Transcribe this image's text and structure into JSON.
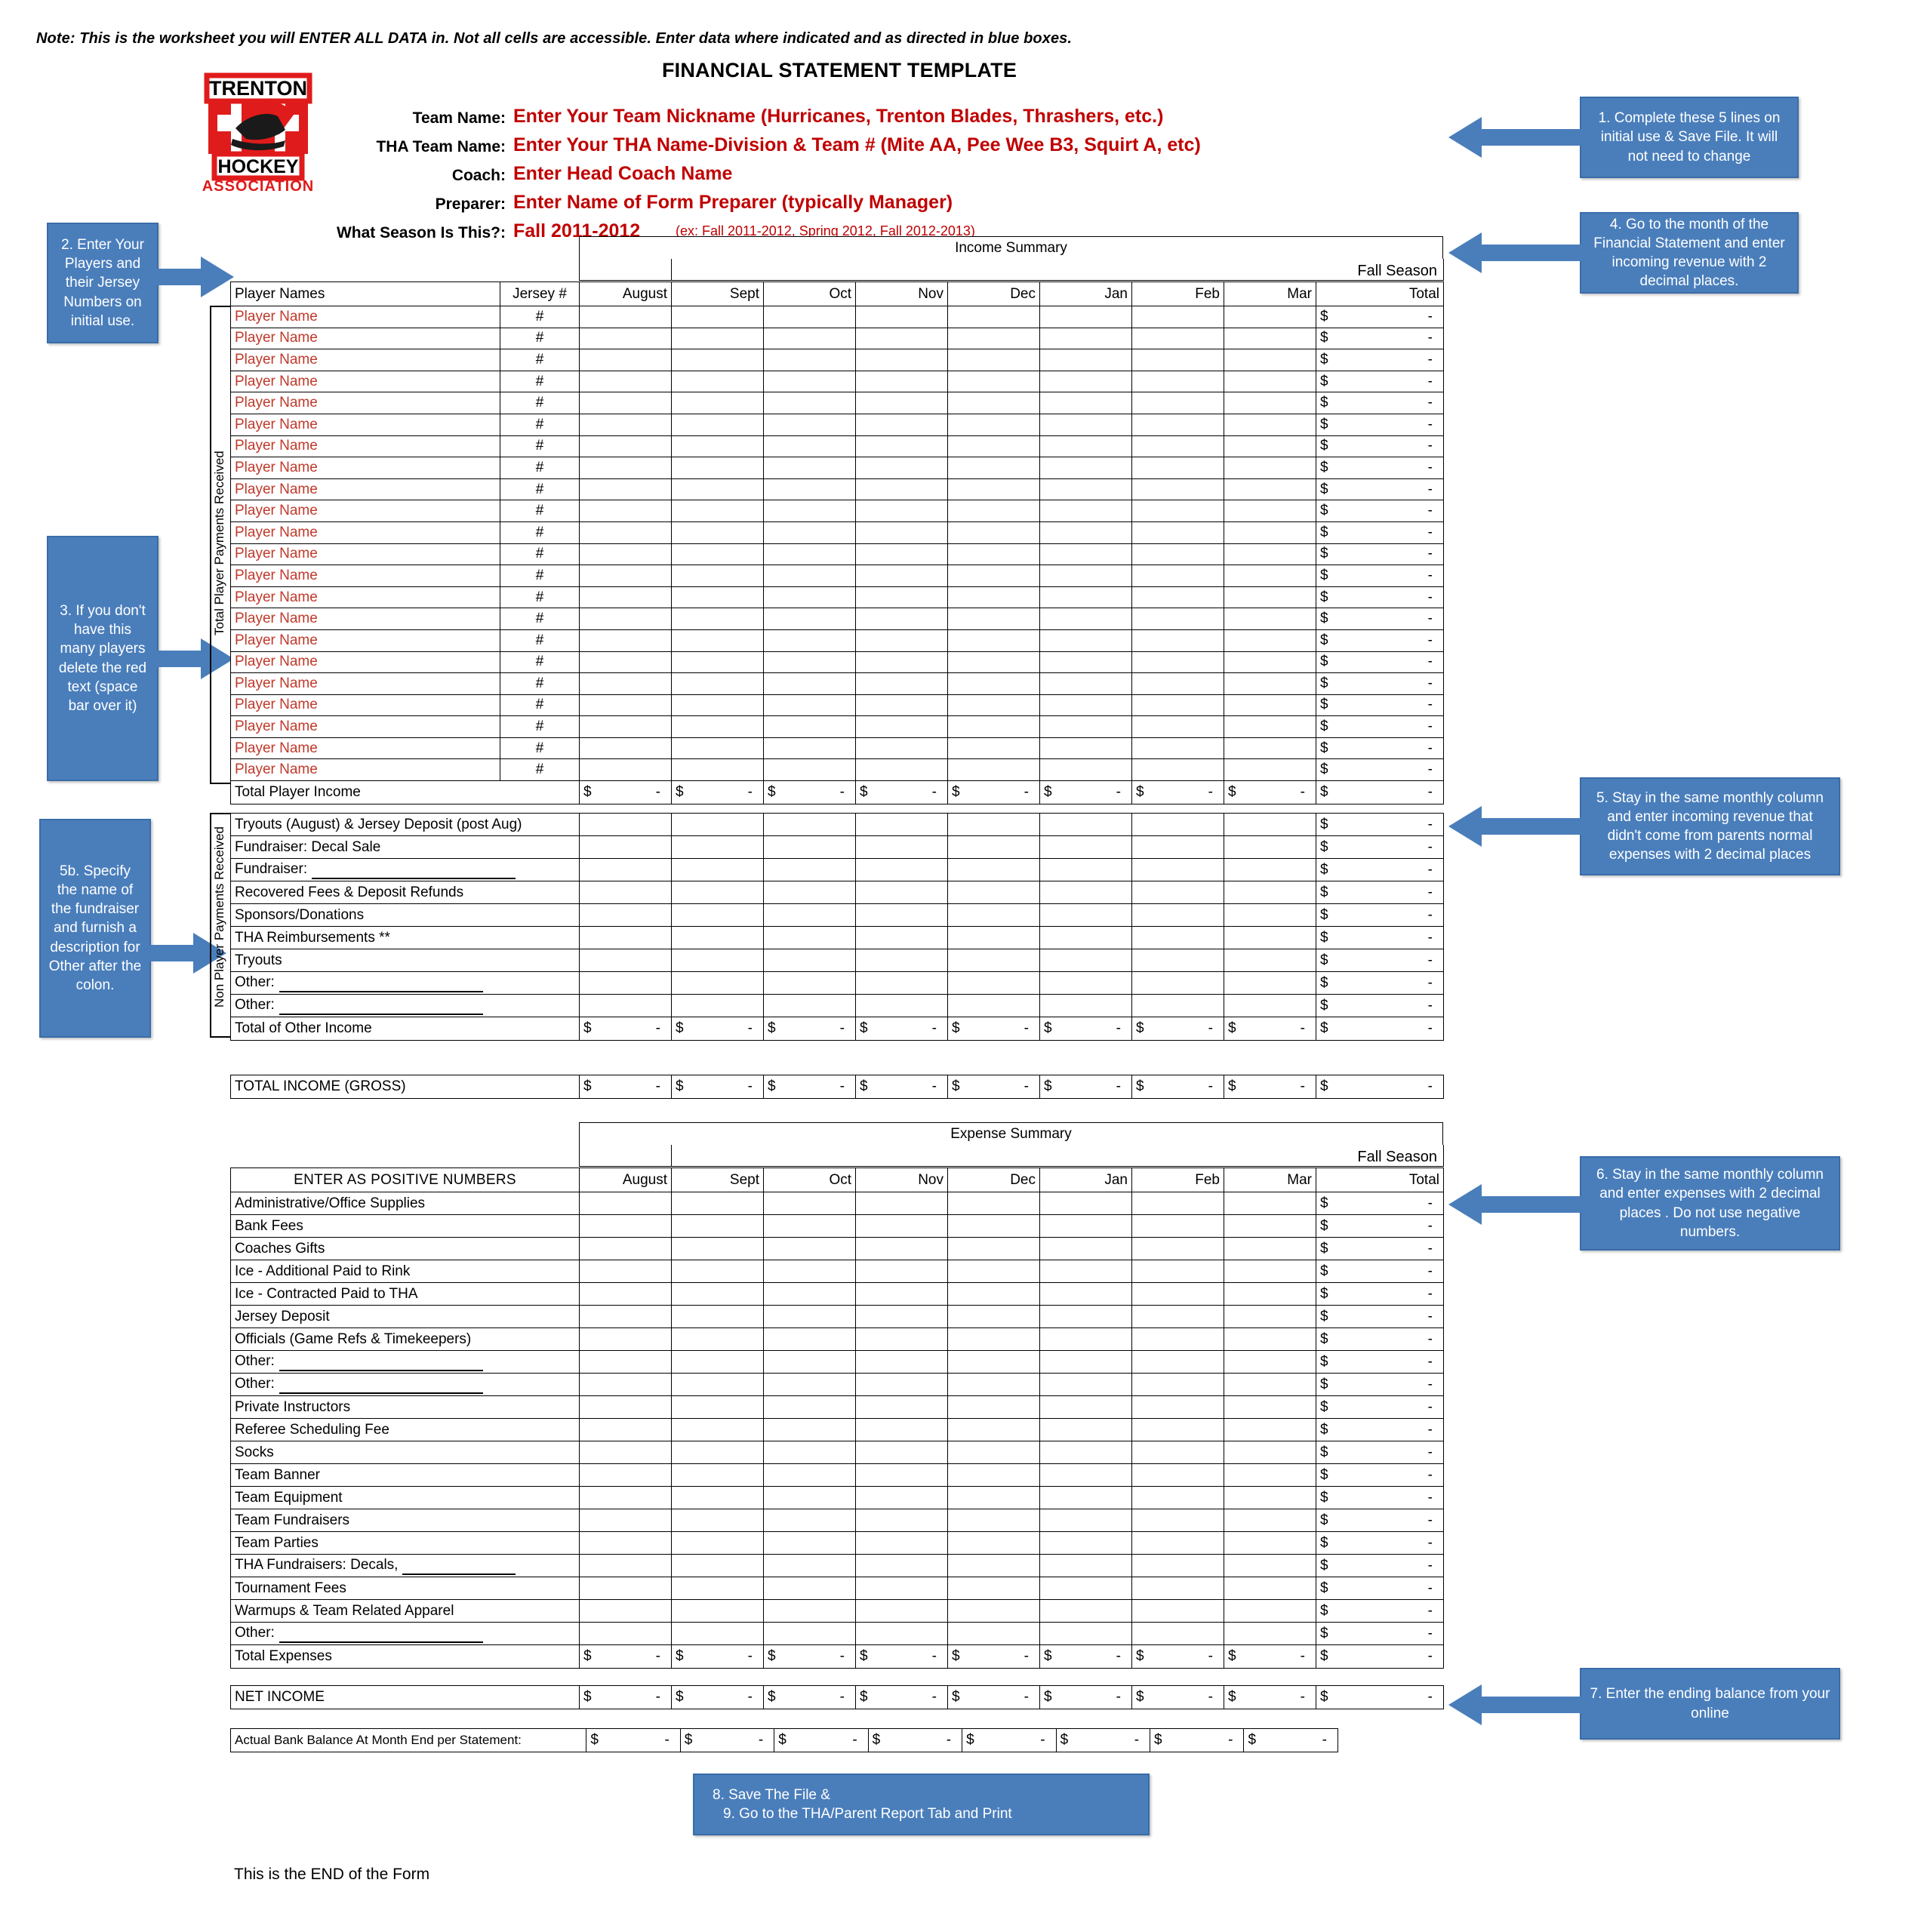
{
  "note": "Note:  This is the worksheet you will ENTER ALL DATA in.  Not all cells are accessible.  Enter data where indicated and as directed in blue boxes.",
  "title": "FINANCIAL STATEMENT TEMPLATE",
  "logo": {
    "line1": "TRENTON",
    "line2": "HOCKEY",
    "line3": "ASSOCIATION",
    "color": "#e01b1b"
  },
  "header_fields": [
    {
      "label": "Team Name:",
      "value": "Enter Your Team Nickname (Hurricanes, Trenton Blades, Thrashers, etc.)",
      "example": ""
    },
    {
      "label": "THA Team Name:",
      "value": "Enter Your THA Name-Division & Team # (Mite AA, Pee Wee B3, Squirt A, etc)",
      "example": ""
    },
    {
      "label": "Coach:",
      "value": "Enter Head Coach Name",
      "example": ""
    },
    {
      "label": "Preparer:",
      "value": "Enter Name of Form Preparer (typically Manager)",
      "example": ""
    },
    {
      "label": "What Season Is This?:",
      "value": "Fall 2011-2012",
      "example": "(ex: Fall 2011-2012, Spring 2012, Fall 2012-2013)"
    }
  ],
  "callouts": [
    {
      "id": "callout-1",
      "text": "1.  Complete these 5  lines on initial use & Save File.  It will not need to change"
    },
    {
      "id": "callout-2",
      "text": "2.  Enter Your Players and their Jersey Numbers on initial use."
    },
    {
      "id": "callout-3",
      "text": "3.  If you don't have this many players delete the red text (space bar over it)"
    },
    {
      "id": "callout-4",
      "text": "4.  Go to the month of the Financial Statement and enter incoming revenue with 2 decimal places."
    },
    {
      "id": "callout-5",
      "text": "5.  Stay in the same monthly column and enter incoming revenue that didn't come from parents normal expenses with 2 decimal places"
    },
    {
      "id": "callout-5b",
      "text": "5b.  Specify the name of the fundraiser and furnish a description for Other after the colon."
    },
    {
      "id": "callout-6",
      "text": "6.  Stay in the same monthly column and enter expenses with 2 decimal places .  Do not use negative numbers."
    },
    {
      "id": "callout-7",
      "text": "7.  Enter the ending balance from your online"
    },
    {
      "id": "callout-89-line1",
      "text": "8.  Save The File &"
    },
    {
      "id": "callout-89-line2",
      "text": "9.  Go to the THA/Parent Report  Tab and Print"
    }
  ],
  "income": {
    "section_title": "Income Summary",
    "col_player_names": "Player Names",
    "col_jersey": "Jersey #",
    "months": [
      "August",
      "Sept",
      "Oct",
      "Nov",
      "Dec",
      "Jan",
      "Feb",
      "Mar"
    ],
    "total_header_line1": "Fall Season",
    "total_header_line2": "Total",
    "side_label_players": "Total Player Payments Received",
    "side_label_nonplayers": "Non Player Payments Received",
    "player_row_label": "Player Name",
    "jersey_placeholder": "#",
    "player_row_count": 22,
    "total_player_income": "Total Player Income",
    "other_income_rows": [
      "Tryouts (August) & Jersey Deposit (post Aug)",
      "Fundraiser: Decal Sale",
      "Fundraiser:",
      "Recovered Fees & Deposit Refunds",
      "Sponsors/Donations",
      "THA Reimbursements **",
      "Tryouts",
      "Other:",
      "Other:"
    ],
    "other_income_blank_rows": [
      2,
      7,
      8
    ],
    "total_other_income": "Total of Other Income",
    "total_income_gross": "TOTAL INCOME (GROSS)",
    "zero_value": "-",
    "currency": "$"
  },
  "expense": {
    "section_title": "Expense Summary",
    "positive_numbers_banner": "ENTER AS POSITIVE NUMBERS",
    "months": [
      "August",
      "Sept",
      "Oct",
      "Nov",
      "Dec",
      "Jan",
      "Feb",
      "Mar"
    ],
    "total_header_line1": "Fall Season",
    "total_header_line2": "Total",
    "rows": [
      "Administrative/Office Supplies",
      "Bank Fees",
      "Coaches Gifts",
      "Ice - Additional Paid to Rink",
      "Ice - Contracted Paid to THA",
      "Jersey Deposit",
      "Officials (Game Refs & Timekeepers)",
      "Other:",
      "Other:",
      "Private Instructors",
      "Referee Scheduling Fee",
      "Socks",
      "Team Banner",
      "Team Equipment",
      "Team Fundraisers",
      "Team Parties",
      "THA Fundraisers:  Decals,",
      "Tournament Fees",
      "Warmups & Team Related Apparel",
      "Other:"
    ],
    "blank_line_rows": [
      7,
      8,
      16,
      19
    ],
    "total_expenses": "Total Expenses",
    "net_income": "NET INCOME"
  },
  "bank_balance": {
    "label": "Actual  Bank Balance At Month End per Statement:",
    "column_count": 8
  },
  "end_of_form": "This is the END of the Form",
  "colors": {
    "callout_blue": "#4a7ebb",
    "red_text": "#c0392b",
    "header_red": "#c00000",
    "money_gray": "#c9c9c9",
    "yellow": "#ffff00"
  }
}
